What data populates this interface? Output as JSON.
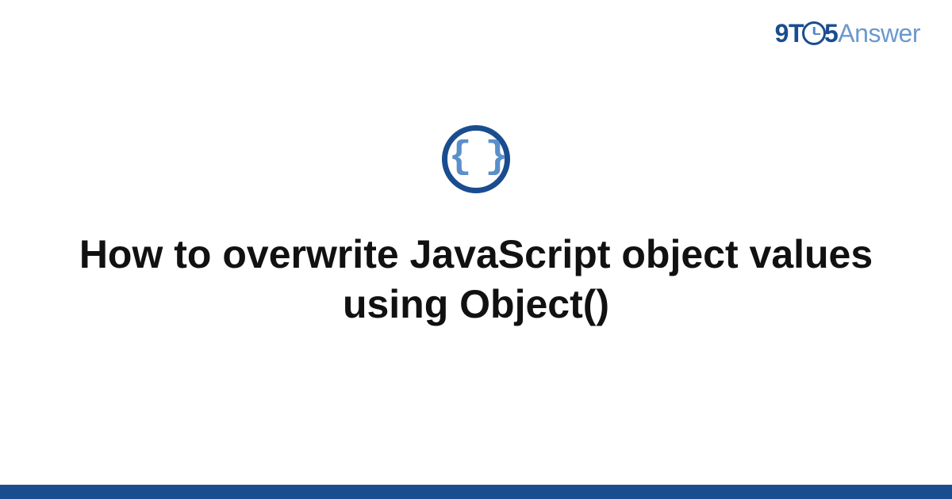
{
  "logo": {
    "prefix_9t": "9T",
    "suffix_5": "5",
    "answer": "Answer"
  },
  "icon": {
    "braces": "{ }",
    "name": "code-braces-icon"
  },
  "title": "How to overwrite JavaScript object values using Object()",
  "colors": {
    "primary": "#1a4d8f",
    "secondary": "#5a8fc9",
    "text": "#111111"
  }
}
